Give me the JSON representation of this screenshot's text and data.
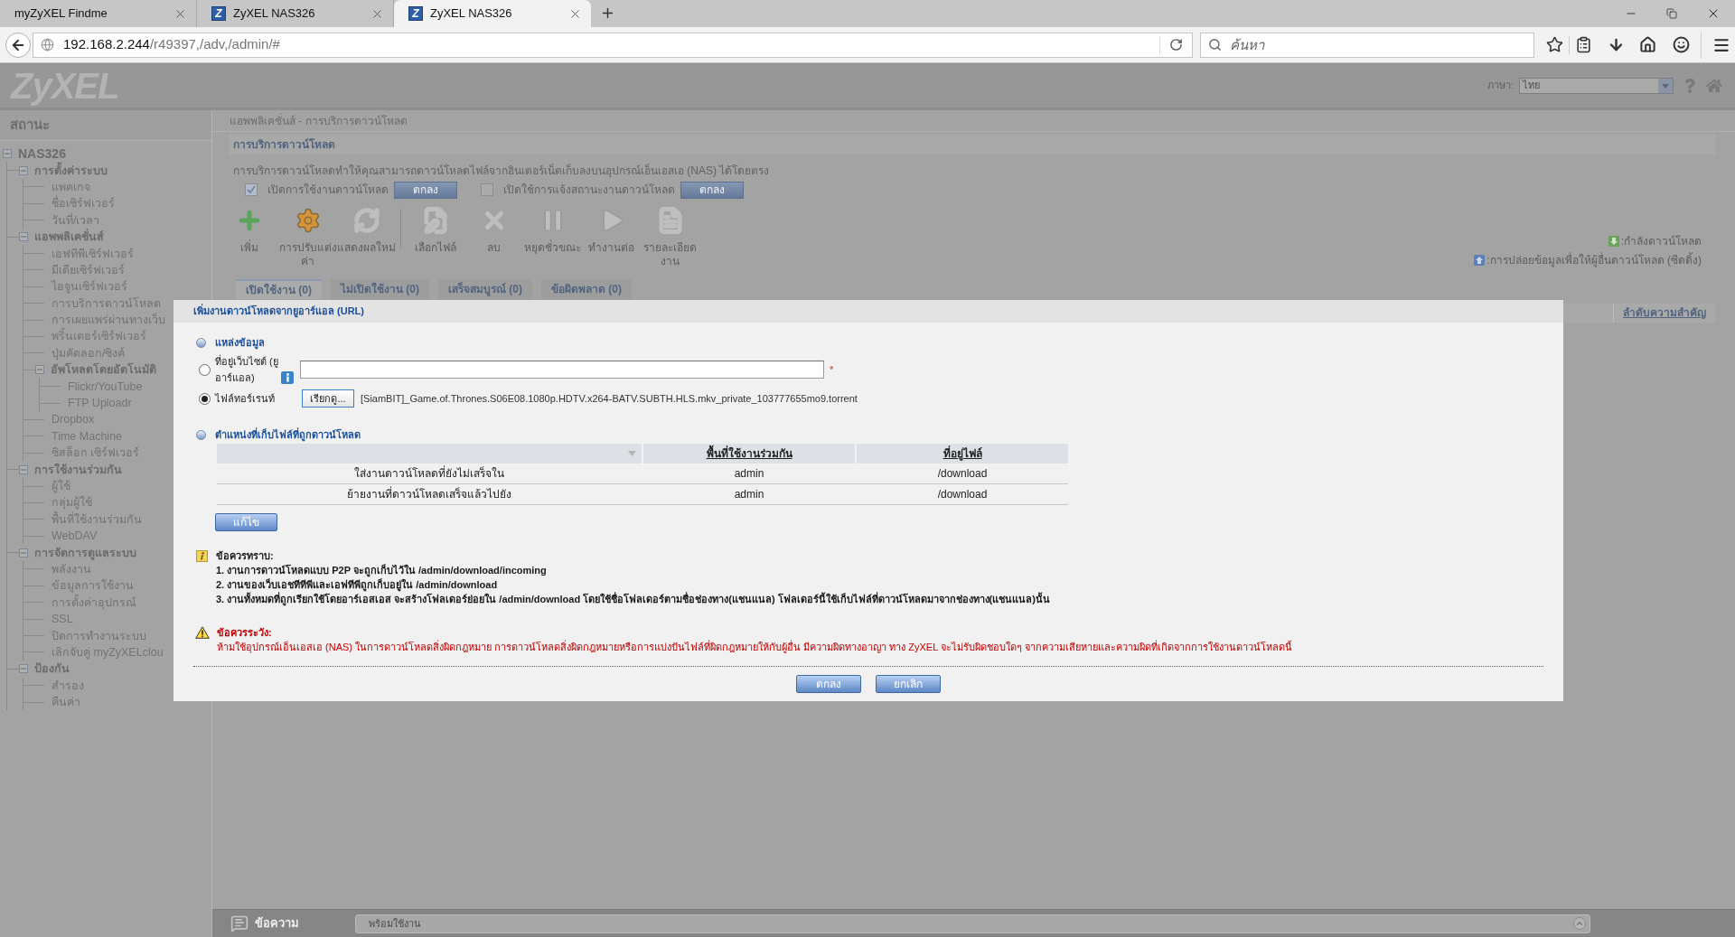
{
  "browser": {
    "tabs": [
      {
        "title": "myZyXEL Findme",
        "selected": false
      },
      {
        "title": "ZyXEL NAS326",
        "favicon": "Z",
        "selected": false
      },
      {
        "title": "ZyXEL NAS326",
        "favicon": "Z",
        "selected": true
      }
    ],
    "address": {
      "host": "192.168.2.244",
      "path": "/r49397,/adv,/admin/#"
    },
    "search": {
      "placeholder": "ค้นหา"
    }
  },
  "header": {
    "logo": "ZyXEL",
    "language": {
      "label": "ภาษา:",
      "value": "ไทย"
    }
  },
  "sidebar": {
    "title": "สถานะ",
    "tree": [
      {
        "label": "NAS326",
        "expanded": true,
        "children": [
          {
            "label": "การตั้งค่าระบบ",
            "expanded": true,
            "children": [
              {
                "label": "แพคเกจ"
              },
              {
                "label": "ชื่อเซิร์ฟเวอร์"
              },
              {
                "label": "วันที่/เวลา"
              }
            ]
          },
          {
            "label": "แอพพลิเคชั่นส์",
            "expanded": true,
            "children": [
              {
                "label": "เอฟทีพีเซิร์ฟเวอร์"
              },
              {
                "label": "มีเดียเซิร์ฟเวอร์"
              },
              {
                "label": "ไอจูนเซิร์ฟเวอร์"
              },
              {
                "label": "การบริการดาวน์โหลด"
              },
              {
                "label": "การเผยแพร่ผ่านทางเว็บ"
              },
              {
                "label": "พริ้นเตอร์เซิร์ฟเวอร์"
              },
              {
                "label": "ปุ่มคัดลอก/ซิงค์"
              },
              {
                "label": "อัพโหลดโดยอัตโนมัติ",
                "expanded": true,
                "children": [
                  {
                    "label": "Flickr/YouTube"
                  },
                  {
                    "label": "FTP Uploadr"
                  }
                ]
              },
              {
                "label": "Dropbox"
              },
              {
                "label": "Time Machine"
              },
              {
                "label": "ซิสล็อก เซิร์ฟเวอร์"
              }
            ]
          },
          {
            "label": "การใช้งานร่วมกัน",
            "expanded": true,
            "children": [
              {
                "label": "ผู้ใช้"
              },
              {
                "label": "กลุ่มผู้ใช้"
              },
              {
                "label": "พื้นที่ใช้งานร่วมกัน"
              },
              {
                "label": "WebDAV"
              }
            ]
          },
          {
            "label": "การจัดการดูแลระบบ",
            "expanded": true,
            "children": [
              {
                "label": "พลังงาน"
              },
              {
                "label": "ข้อมูลการใช้งาน"
              },
              {
                "label": "การตั้งค่าอุปกรณ์"
              },
              {
                "label": "SSL"
              },
              {
                "label": "ปิดการทำงานระบบ"
              },
              {
                "label": "เลิกจับคู่ myZyXELclou"
              }
            ]
          },
          {
            "label": "ป้องกัน",
            "expanded": true,
            "children": [
              {
                "label": "สำรอง"
              },
              {
                "label": "คืนค่า"
              }
            ]
          }
        ]
      }
    ]
  },
  "breadcrumb": "แอพพลิเคชั่นส์ - การบริการดาวน์โหลด",
  "section": {
    "title": "การบริการดาวน์โหลด",
    "description": "การบริการดาวน์โหลดทำให้คุณสามารถดาวน์โหลดไฟล์จากอินเตอร์เน็ตเก็บลงบนอุปกรณ์เอ็นเอสเอ (NAS) ได้โดยตรง"
  },
  "options": [
    {
      "label": "เปิดการใช้งานดาวน์โหลด",
      "checked": true,
      "button": "ตกลง"
    },
    {
      "label": "เปิดใช้การแจ้งสถานะงานดาวน์โหลด",
      "checked": false,
      "button": "ตกลง"
    }
  ],
  "toolbar": [
    [
      {
        "label": "เพิ่ม",
        "disabled": false
      },
      {
        "label": "การปรับแต่งค่า",
        "disabled": false
      },
      {
        "label": "แสดงผลใหม่",
        "disabled": true
      }
    ],
    [
      {
        "label": "เลือกไฟล์",
        "disabled": true
      },
      {
        "label": "ลบ",
        "disabled": true
      },
      {
        "label": "หยุดชั่วขณะ",
        "disabled": true
      },
      {
        "label": "ทำงานต่อ",
        "disabled": true
      },
      {
        "label": "รายละเอียดงาน",
        "disabled": true
      }
    ]
  ],
  "legend": [
    ":กำลังดาวน์โหลด",
    ":การปล่อยข้อมูลเพื่อให้ผู้อื่นดาวน์โหลด (ซีดดิ้ง)"
  ],
  "job_tabs": [
    {
      "label": "เปิดใช้งาน (0)",
      "selected": true
    },
    {
      "label": "ไม่เปิดใช้งาน (0)",
      "selected": false
    },
    {
      "label": "เสร็จสมบูรณ์ (0)",
      "selected": false
    },
    {
      "label": "ข้อผิดพลาด (0)",
      "selected": false
    }
  ],
  "job_table": {
    "columns": [
      "ลำดับความสำคัญ"
    ]
  },
  "dialog": {
    "title": "เพิ่มงานดาวน์โหลดจากยูอาร์แอล (URL)",
    "source": {
      "heading": "แหล่งข้อมูล",
      "choices": [
        {
          "kind": "url",
          "label": "ที่อยู่เว็บไซต์ (ยูอาร์แอล)",
          "selected": false,
          "required_mark": "*"
        },
        {
          "kind": "file",
          "label": "ไฟล์ทอร์เรนท์",
          "selected": true,
          "button": "เรียกดู...",
          "file_name": "[SiamBIT]_Game.of.Thrones.S06E08.1080p.HDTV.x264-BATV.SUBTH.HLS.mkv_private_103777655mo9.torrent"
        }
      ]
    },
    "destination": {
      "heading": "ตำแหน่งที่เก็บไฟล์ที่ถูกดาวน์โหลด",
      "columns": [
        "",
        "พื้นที่ใช้งานร่วมกัน",
        "ที่อยู่ไฟล์"
      ],
      "rows": [
        [
          "ใส่งานดาวน์โหลดที่ยังไม่เสร็จใน",
          "admin",
          "/download"
        ],
        [
          "ย้ายงานที่ดาวน์โหลดเสร็จแล้วไปยัง",
          "admin",
          "/download"
        ]
      ],
      "edit_button": "แก้ไข"
    },
    "notes": {
      "heading": "ข้อควรทราบ:",
      "items": [
        "1. งานการดาวน์โหลดแบบ P2P จะถูกเก็บไว้ใน /admin/download/incoming",
        "2. งานของเว็บเอชทีทีพีและเอฟทีพีถูกเก็บอยู่ใน /admin/download",
        "3. งานทั้งหมดที่ถูกเรียกใช้โดยอาร์เอสเอส จะสร้างโฟลเดอร์ย่อยใน /admin/download โดยใช้ชื่อโฟลเดอร์ตามชื่อช่องทาง(แชนแนล) โฟลเดอร์นี้ใช้เก็บไฟล์ที่ดาวน์โหลดมาจากช่องทาง(แชนแนล)นั้น"
      ]
    },
    "warning": {
      "heading": "ข้อควรระวัง:",
      "text": "ห้ามใช้อุปกรณ์เอ็นเอสเอ (NAS) ในการดาวน์โหลดสิ่งผิดกฎหมาย การดาวน์โหลดสิ่งผิดกฎหมายหรือการแบ่งปันไฟล์ที่ผิดกฎหมายให้กับผู้อื่น มีความผิดทางอาญา ทาง ZyXEL จะไม่รับผิดชอบใดๆ จากความเสียหายและความผิดที่เกิดจากการใช้งานดาวน์โหลดนี้"
    },
    "buttons": [
      "ตกลง",
      "ยกเลิก"
    ]
  },
  "status_bar": {
    "label": "ข้อความ",
    "message": "พร้อมใช้งาน"
  }
}
